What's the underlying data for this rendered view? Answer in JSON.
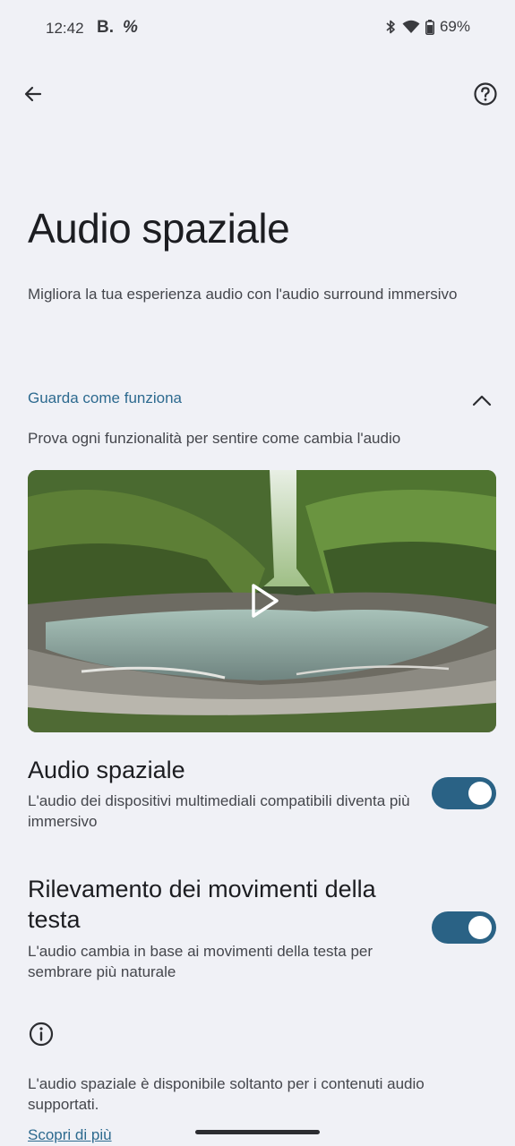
{
  "status_bar": {
    "time": "12:42",
    "app_icon_1": "B.",
    "app_icon_2": "%",
    "battery": "69%",
    "icons": [
      "bluetooth-icon",
      "wifi-icon",
      "battery-icon"
    ]
  },
  "header": {
    "back_icon": "arrow-left-icon",
    "help_icon": "help-circle-icon"
  },
  "page": {
    "title": "Audio spaziale",
    "subtitle": "Migliora la tua esperienza audio con l'audio surround immersivo"
  },
  "demo_section": {
    "heading": "Guarda come funziona",
    "expanded": true,
    "description": "Prova ogni funzionalità per sentire come cambia l'audio",
    "video_icon": "play-icon"
  },
  "settings": [
    {
      "title": "Audio spaziale",
      "description": "L'audio dei dispositivi multimediali compatibili diventa più immersivo",
      "enabled": true
    },
    {
      "title": "Rilevamento dei movimenti della testa",
      "description": "L'audio cambia in base ai movimenti della testa per sembrare più naturale",
      "enabled": true
    }
  ],
  "footer": {
    "info_icon": "info-icon",
    "note": "L'audio spaziale è disponibile soltanto per i contenuti audio supportati.",
    "learn_more": "Scopri di più"
  },
  "colors": {
    "background": "#f0f1f6",
    "accent": "#2d6a8f",
    "toggle_on": "#2a6285"
  }
}
